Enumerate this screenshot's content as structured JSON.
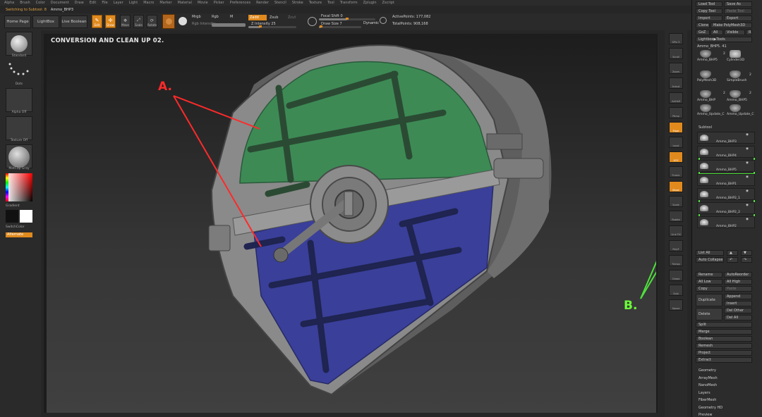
{
  "menu": [
    "Alpha",
    "Brush",
    "Color",
    "Document",
    "Draw",
    "Edit",
    "File",
    "Layer",
    "Light",
    "Macro",
    "Marker",
    "Material",
    "Movie",
    "Picker",
    "Preferences",
    "Render",
    "Stencil",
    "Stroke",
    "Texture",
    "Tool",
    "Transform",
    "Zplugin",
    "Zscript"
  ],
  "status": {
    "message": "Switching to Subtool: 8",
    "tool_name": "Ammo_BHP3"
  },
  "topbar": {
    "home_page": "Home Page",
    "lightbox": "LightBox",
    "live_boolean": "Live Boolean",
    "edit": "Edit",
    "draw": "Draw",
    "move": "Move",
    "scale": "Scale",
    "rotate": "Rotate",
    "mrgb": "Mrgb",
    "rgb": "Rgb",
    "m": "M",
    "rgb_intensity": "Rgb Intensity",
    "zadd": "Zadd",
    "zsub": "Zsub",
    "zcut": "Zcut",
    "z_intensity": "Z Intensity 25",
    "focal_shift": "Focal Shift 0",
    "draw_size": "Draw Size 7",
    "dynamic": "Dynamic",
    "active_points": "ActivePoints: 177,082",
    "total_points": "TotalPoints: 908,168",
    "z_intensity_value": 0.25,
    "focal_shift_value": 0.5,
    "draw_size_value": 0.05
  },
  "left_shelf": {
    "standard": "Standard",
    "dots": "Dots",
    "alpha_off": "Alpha Off",
    "texture_off": "Texture Off",
    "matcap": "MatCap Gray",
    "gradient": "Gradient",
    "switch_color": "SwitchColor",
    "alternate": "Alternate"
  },
  "canvas": {
    "title": "CONVERSION AND CLEAN UP 02.",
    "label_a": "A.",
    "label_b": "B."
  },
  "right_shelf": [
    "SPix 3",
    "Scroll",
    "Zoom",
    "Actual",
    "AAHalf",
    "Persp",
    "Floor",
    "Local",
    "XYZ",
    "Frame",
    "Move",
    "Scale",
    "Rotate",
    "Line Fill",
    "PolyF",
    "Transp",
    "Ghost",
    "Solo",
    "Xpose"
  ],
  "tray": {
    "load_tool": "Load Tool",
    "save_as": "Save As",
    "copy_tool": "Copy Tool",
    "paste_tool": "Paste Tool",
    "import": "Import",
    "export": "Export",
    "clone": "Clone",
    "make_polymesh": "Make PolyMesh3D",
    "goz": "GoZ",
    "all": "All",
    "visible": "Visible",
    "r": "R",
    "lightbox_tools": "Lightbox▶Tools",
    "current_tool": "Ammo_BHP5. 41",
    "tool_thumbs": [
      "Ammo_BHP5",
      "Cylinder3D",
      "PolyMesh3D",
      "SimpleBrush",
      "Ammo_BHP",
      "Ammo_BHP5",
      "Ammo_Update_C",
      "Ammo_Update_C"
    ],
    "thumb_counts": [
      "2",
      "2",
      "2",
      "2"
    ],
    "subtool_header": "Subtool",
    "subtools": [
      "Ammo_BHP3",
      "Ammo_BHP4",
      "Ammo_BHP5",
      "Ammo_BHP1",
      "Ammo_BHP2_1",
      "Ammo_BHP2_2",
      "Ammo_BHP2"
    ],
    "list_all": "List All",
    "auto_collapse": "Auto Collapse",
    "rename": "Rename",
    "auto_reorder": "AutoReorder",
    "all_low": "All Low",
    "all_high": "All High",
    "copy": "Copy",
    "paste": "Paste",
    "duplicate": "Duplicate",
    "append": "Append",
    "insert": "Insert",
    "delete": "Delete",
    "del_other": "Del Other",
    "del_all": "Del All",
    "split": "Split",
    "merge": "Merge",
    "boolean": "Boolean",
    "remesh": "Remesh",
    "project": "Project",
    "extract": "Extract",
    "sections": [
      "Geometry",
      "ArrayMesh",
      "NanoMesh",
      "Layers",
      "FiberMesh",
      "Geometry HD",
      "Preview"
    ]
  },
  "colors": {
    "accent": "#e08a1e",
    "annotation_a": "#ff2a2a",
    "annotation_b": "#4ee03c",
    "polygroup_green": "#3d8a55",
    "polygroup_blue": "#3a3f9a",
    "mesh_gray": "#7c7c7c"
  }
}
